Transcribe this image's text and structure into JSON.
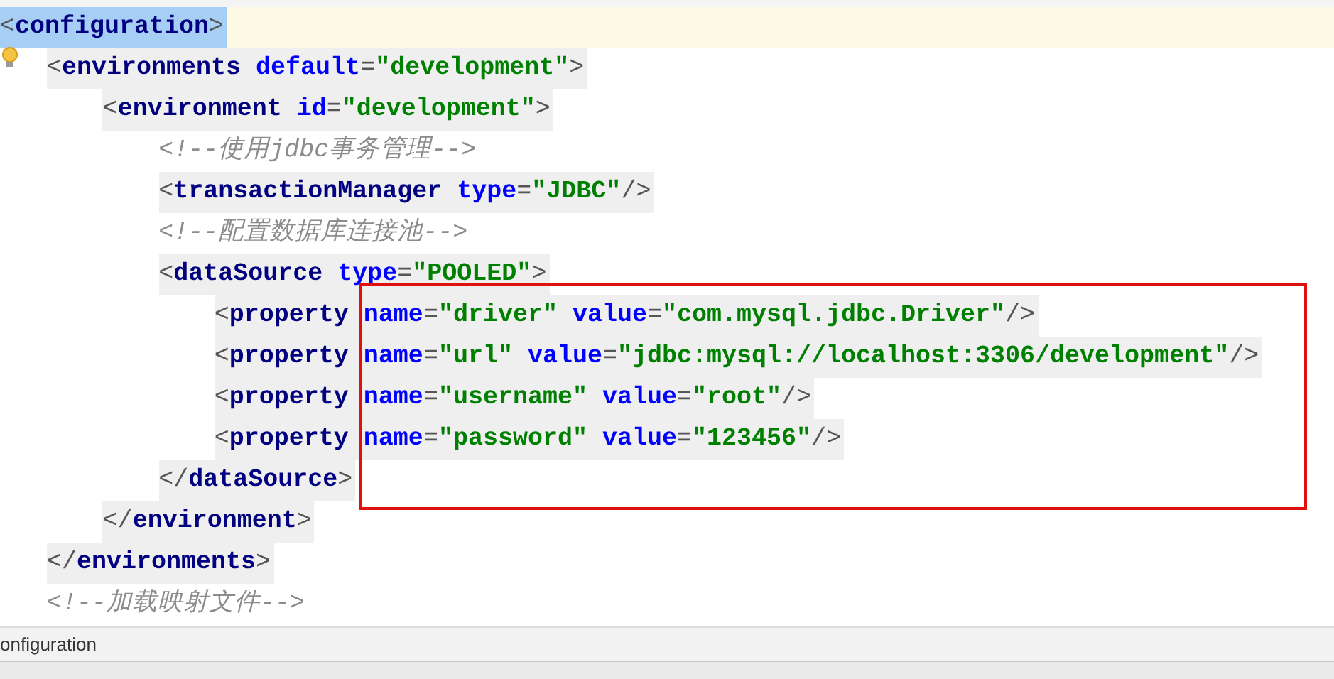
{
  "editor": {
    "lines": [
      {
        "selected": true,
        "tokens": [
          {
            "kind": "punct",
            "text": "<"
          },
          {
            "kind": "tag",
            "text": "configuration"
          },
          {
            "kind": "punct",
            "text": ">"
          }
        ],
        "children": [
          {
            "selected": false,
            "highlighted": true,
            "tokens": [
              {
                "kind": "punct",
                "text": "<"
              },
              {
                "kind": "tag",
                "text": "environments"
              },
              {
                "kind": "attr",
                "text": " default"
              },
              {
                "kind": "punct",
                "text": "="
              },
              {
                "kind": "value",
                "text": "\"development\""
              },
              {
                "kind": "punct",
                "text": ">"
              }
            ],
            "children": [
              {
                "selected": false,
                "highlighted": true,
                "tokens": [
                  {
                    "kind": "punct",
                    "text": "<"
                  },
                  {
                    "kind": "tag",
                    "text": "environment"
                  },
                  {
                    "kind": "attr",
                    "text": " id"
                  },
                  {
                    "kind": "punct",
                    "text": "="
                  },
                  {
                    "kind": "value",
                    "text": "\"development\""
                  },
                  {
                    "kind": "punct",
                    "text": ">"
                  }
                ],
                "children": [
                  {
                    "selected": false,
                    "highlighted": false,
                    "tokens": [
                      {
                        "kind": "comment",
                        "text": "<!--使用jdbc事务管理-->"
                      }
                    ]
                  },
                  {
                    "selected": false,
                    "highlighted": true,
                    "tokens": [
                      {
                        "kind": "punct",
                        "text": "<"
                      },
                      {
                        "kind": "tag",
                        "text": "transactionManager"
                      },
                      {
                        "kind": "attr",
                        "text": " type"
                      },
                      {
                        "kind": "punct",
                        "text": "="
                      },
                      {
                        "kind": "value",
                        "text": "\"JDBC\""
                      },
                      {
                        "kind": "punct",
                        "text": "/>"
                      }
                    ]
                  },
                  {
                    "selected": false,
                    "highlighted": false,
                    "tokens": [
                      {
                        "kind": "comment",
                        "text": "<!--配置数据库连接池-->"
                      }
                    ]
                  },
                  {
                    "selected": false,
                    "highlighted": true,
                    "tokens": [
                      {
                        "kind": "punct",
                        "text": "<"
                      },
                      {
                        "kind": "tag",
                        "text": "dataSource"
                      },
                      {
                        "kind": "attr",
                        "text": " type"
                      },
                      {
                        "kind": "punct",
                        "text": "="
                      },
                      {
                        "kind": "value",
                        "text": "\"POOLED\""
                      },
                      {
                        "kind": "punct",
                        "text": ">"
                      }
                    ],
                    "children": [
                      {
                        "selected": false,
                        "highlighted": true,
                        "tokens": [
                          {
                            "kind": "punct",
                            "text": "<"
                          },
                          {
                            "kind": "tag",
                            "text": "property"
                          },
                          {
                            "kind": "attr",
                            "text": " name"
                          },
                          {
                            "kind": "punct",
                            "text": "="
                          },
                          {
                            "kind": "value",
                            "text": "\"driver\""
                          },
                          {
                            "kind": "attr",
                            "text": " value"
                          },
                          {
                            "kind": "punct",
                            "text": "="
                          },
                          {
                            "kind": "value",
                            "text": "\"com.mysql.jdbc.Driver\""
                          },
                          {
                            "kind": "punct",
                            "text": "/>"
                          }
                        ]
                      },
                      {
                        "selected": false,
                        "highlighted": true,
                        "tokens": [
                          {
                            "kind": "punct",
                            "text": "<"
                          },
                          {
                            "kind": "tag",
                            "text": "property"
                          },
                          {
                            "kind": "attr",
                            "text": " name"
                          },
                          {
                            "kind": "punct",
                            "text": "="
                          },
                          {
                            "kind": "value",
                            "text": "\"url\""
                          },
                          {
                            "kind": "attr",
                            "text": " value"
                          },
                          {
                            "kind": "punct",
                            "text": "="
                          },
                          {
                            "kind": "value",
                            "text": "\"jdbc:mysql://localhost:3306/development\""
                          },
                          {
                            "kind": "punct",
                            "text": "/>"
                          }
                        ]
                      },
                      {
                        "selected": false,
                        "highlighted": true,
                        "tokens": [
                          {
                            "kind": "punct",
                            "text": "<"
                          },
                          {
                            "kind": "tag",
                            "text": "property"
                          },
                          {
                            "kind": "attr",
                            "text": " name"
                          },
                          {
                            "kind": "punct",
                            "text": "="
                          },
                          {
                            "kind": "value",
                            "text": "\"username\""
                          },
                          {
                            "kind": "attr",
                            "text": " value"
                          },
                          {
                            "kind": "punct",
                            "text": "="
                          },
                          {
                            "kind": "value",
                            "text": "\"root\""
                          },
                          {
                            "kind": "punct",
                            "text": "/>"
                          }
                        ]
                      },
                      {
                        "selected": false,
                        "highlighted": true,
                        "tokens": [
                          {
                            "kind": "punct",
                            "text": "<"
                          },
                          {
                            "kind": "tag",
                            "text": "property"
                          },
                          {
                            "kind": "attr",
                            "text": " name"
                          },
                          {
                            "kind": "punct",
                            "text": "="
                          },
                          {
                            "kind": "value",
                            "text": "\"password\""
                          },
                          {
                            "kind": "attr",
                            "text": " value"
                          },
                          {
                            "kind": "punct",
                            "text": "="
                          },
                          {
                            "kind": "value",
                            "text": "\"123456\""
                          },
                          {
                            "kind": "punct",
                            "text": "/>"
                          }
                        ]
                      }
                    ]
                  },
                  {
                    "selected": false,
                    "highlighted": true,
                    "tokens": [
                      {
                        "kind": "punct",
                        "text": "</"
                      },
                      {
                        "kind": "tag",
                        "text": "dataSource"
                      },
                      {
                        "kind": "punct",
                        "text": ">"
                      }
                    ]
                  }
                ]
              },
              {
                "selected": false,
                "highlighted": true,
                "tokens": [
                  {
                    "kind": "punct",
                    "text": "</"
                  },
                  {
                    "kind": "tag",
                    "text": "environment"
                  },
                  {
                    "kind": "punct",
                    "text": ">"
                  }
                ]
              }
            ]
          },
          {
            "selected": false,
            "highlighted": true,
            "tokens": [
              {
                "kind": "punct",
                "text": "</"
              },
              {
                "kind": "tag",
                "text": "environments"
              },
              {
                "kind": "punct",
                "text": ">"
              }
            ]
          },
          {
            "selected": false,
            "highlighted": false,
            "tokens": [
              {
                "kind": "comment",
                "text": "<!--加载映射文件-->"
              }
            ]
          }
        ]
      }
    ],
    "annotation": {
      "kind": "rectangle",
      "color": "#e01010"
    }
  },
  "breadcrumb": {
    "text": "onfiguration"
  }
}
